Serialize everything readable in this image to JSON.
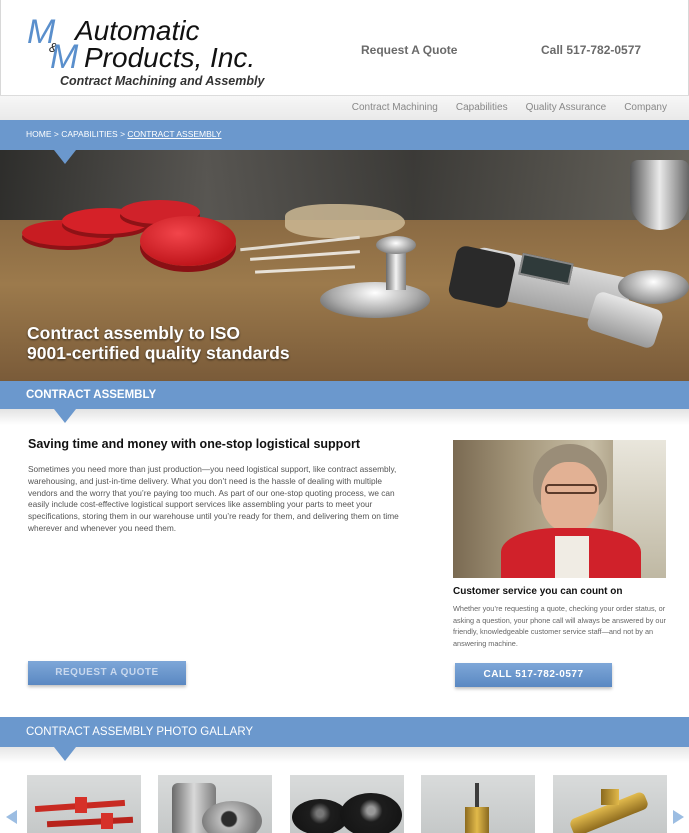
{
  "header": {
    "logo_m1": "M",
    "logo_amp": "&",
    "logo_m2": "M",
    "logo_line1": "Automatic",
    "logo_line2": "Products, Inc.",
    "logo_tagline": "Contract Machining and Assembly",
    "request_quote": "Request A Quote",
    "phone": "Call 517-782-0577"
  },
  "nav": {
    "items": [
      "Contract Machining",
      "Capabilities",
      "Quality Assurance",
      "Company"
    ]
  },
  "breadcrumb": {
    "home": "HOME",
    "sep1": " > ",
    "capabilities": "CAPABILITIES",
    "sep2": " > ",
    "current": "CONTRACT ASSEMBLY"
  },
  "hero": {
    "caption_line1": "Contract assembly to ISO",
    "caption_line2": "9001-certified quality standards"
  },
  "section": {
    "title": "CONTRACT ASSEMBLY"
  },
  "main": {
    "heading": "Saving time and money with one-stop logistical support",
    "body": "Sometimes you need more than just production—you need logistical support, like contract assembly, warehousing, and just-in-time delivery. What you don’t need is the hassle of dealing with multiple vendors and the worry that you’re paying too much. As part of our one-stop quoting process, we can easily include cost-effective logistical support services like assembling your parts to meet your specifications, storing them in our warehouse until you’re ready for them, and delivering them on time wherever and whenever you need them.",
    "cta_quote": "REQUEST A QUOTE"
  },
  "sidebar": {
    "heading": "Customer service you can count on",
    "body": "Whether you’re requesting a quote, checking your order status, or asking a question, your phone call will always be answered by our friendly, knowledgeable customer service staff—and not by an answering machine.",
    "cta_call": "CALL 517-782-0577"
  },
  "gallery": {
    "title": "CONTRACT ASSEMBLY PHOTO GALLARY"
  },
  "colors": {
    "accent": "#6b98cd",
    "logo_blue": "#5a8fcc"
  }
}
